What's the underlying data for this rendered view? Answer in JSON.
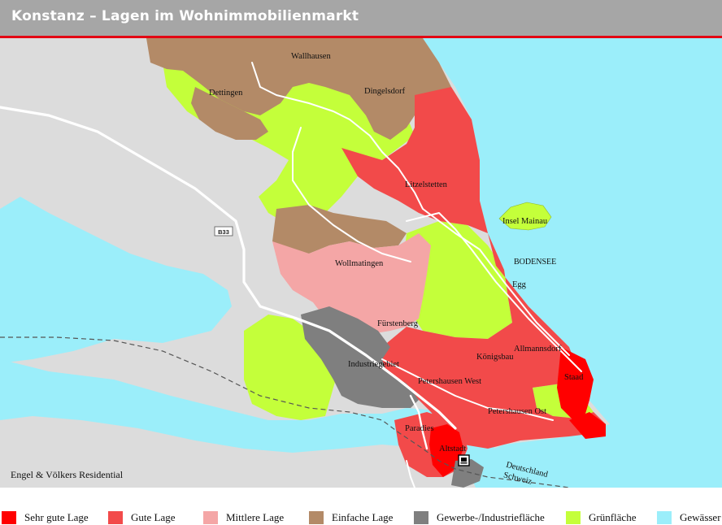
{
  "header": {
    "title": "Konstanz – Lagen im Wohnimmobilienmarkt"
  },
  "map": {
    "road_label": "B33",
    "places": {
      "wallhausen": "Wallhausen",
      "dettingen": "Dettingen",
      "dingelsdorf": "Dingelsdorf",
      "litzelstetten": "Litzelstetten",
      "insel_mainau": "Insel Mainau",
      "bodensee": "BODENSEE",
      "wollmatingen": "Wollmatingen",
      "egg": "Egg",
      "fuerstenberg": "Fürstenberg",
      "allmannsdorf": "Allmannsdorf",
      "industriegebiet": "Industriegebiet",
      "koenigsbau": "Königsbau",
      "staad": "Staad",
      "petershausen_west": "Petershausen West",
      "petershausen_ost": "Petershausen Ost",
      "paradies": "Paradies",
      "altstadt": "Altstadt"
    },
    "border": {
      "north": "Deutschland",
      "south": "Schweiz"
    },
    "station_icon": "train-station-icon",
    "credit": "Engel & Völkers Residential"
  },
  "colors": {
    "sehr_gut": "#ff0000",
    "gut": "#f24a4a",
    "mittel": "#f4a6a6",
    "einfach": "#b38a67",
    "gewerbe": "#7f7f7f",
    "gruen": "#c4ff3a",
    "wasser": "#9beefa",
    "land": "#dcdcdc"
  },
  "legend": [
    {
      "label": "Sehr gute Lage",
      "color": "#ff0000"
    },
    {
      "label": "Gute Lage",
      "color": "#f24a4a"
    },
    {
      "label": "Mittlere Lage",
      "color": "#f4a6a6"
    },
    {
      "label": "Einfache Lage",
      "color": "#b38a67"
    },
    {
      "label": "Gewerbe-/Industriefläche",
      "color": "#7f7f7f"
    },
    {
      "label": "Grünfläche",
      "color": "#c4ff3a"
    },
    {
      "label": "Gewässer",
      "color": "#9beefa"
    }
  ]
}
